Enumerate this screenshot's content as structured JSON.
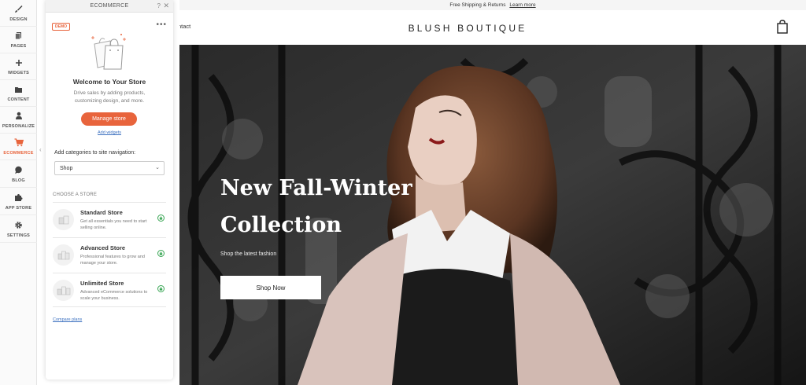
{
  "sidebar": {
    "items": [
      {
        "label": "DESIGN",
        "icon": "brush-icon"
      },
      {
        "label": "PAGES",
        "icon": "pages-icon"
      },
      {
        "label": "WIDGETS",
        "icon": "plus-icon"
      },
      {
        "label": "CONTENT",
        "icon": "folder-icon"
      },
      {
        "label": "PERSONALIZE",
        "icon": "person-icon"
      },
      {
        "label": "ECOMMERCE",
        "icon": "cart-icon"
      },
      {
        "label": "BLOG",
        "icon": "chat-bubble-icon"
      },
      {
        "label": "APP STORE",
        "icon": "puzzle-icon"
      },
      {
        "label": "SETTINGS",
        "icon": "gear-icon"
      }
    ],
    "active": "ECOMMERCE",
    "accent": "#e8643c"
  },
  "panel": {
    "title": "ECOMMERCE",
    "help": "?",
    "close": "✕",
    "badge": "DEMO",
    "more": "•••",
    "welcome_title": "Welcome to Your Store",
    "welcome_desc": "Drive sales by adding products, customizing design, and more.",
    "manage_button": "Manage store",
    "add_widgets": "Add widgets",
    "category_label": "Add categories to site navigation:",
    "category_value": "Shop",
    "choose_label": "CHOOSE A STORE",
    "stores": [
      {
        "name": "Standard Store",
        "desc": "Get all essentials you need to start selling online."
      },
      {
        "name": "Advanced Store",
        "desc": "Professional features to grow and manage your store."
      },
      {
        "name": "Unlimited Store",
        "desc": "Advanced eCommerce solutions to scale your business."
      }
    ],
    "compare_link": "Compare plans"
  },
  "site": {
    "announcement": "Free Shipping & Returns",
    "announcement_link": "Learn more",
    "nav_partial": "ntact",
    "brand": "BLUSH BOUTIQUE",
    "hero": {
      "title_line1": "New Fall-Winter",
      "title_line2": "Collection",
      "subtitle": "Shop the latest fashion",
      "button": "Shop Now"
    }
  }
}
